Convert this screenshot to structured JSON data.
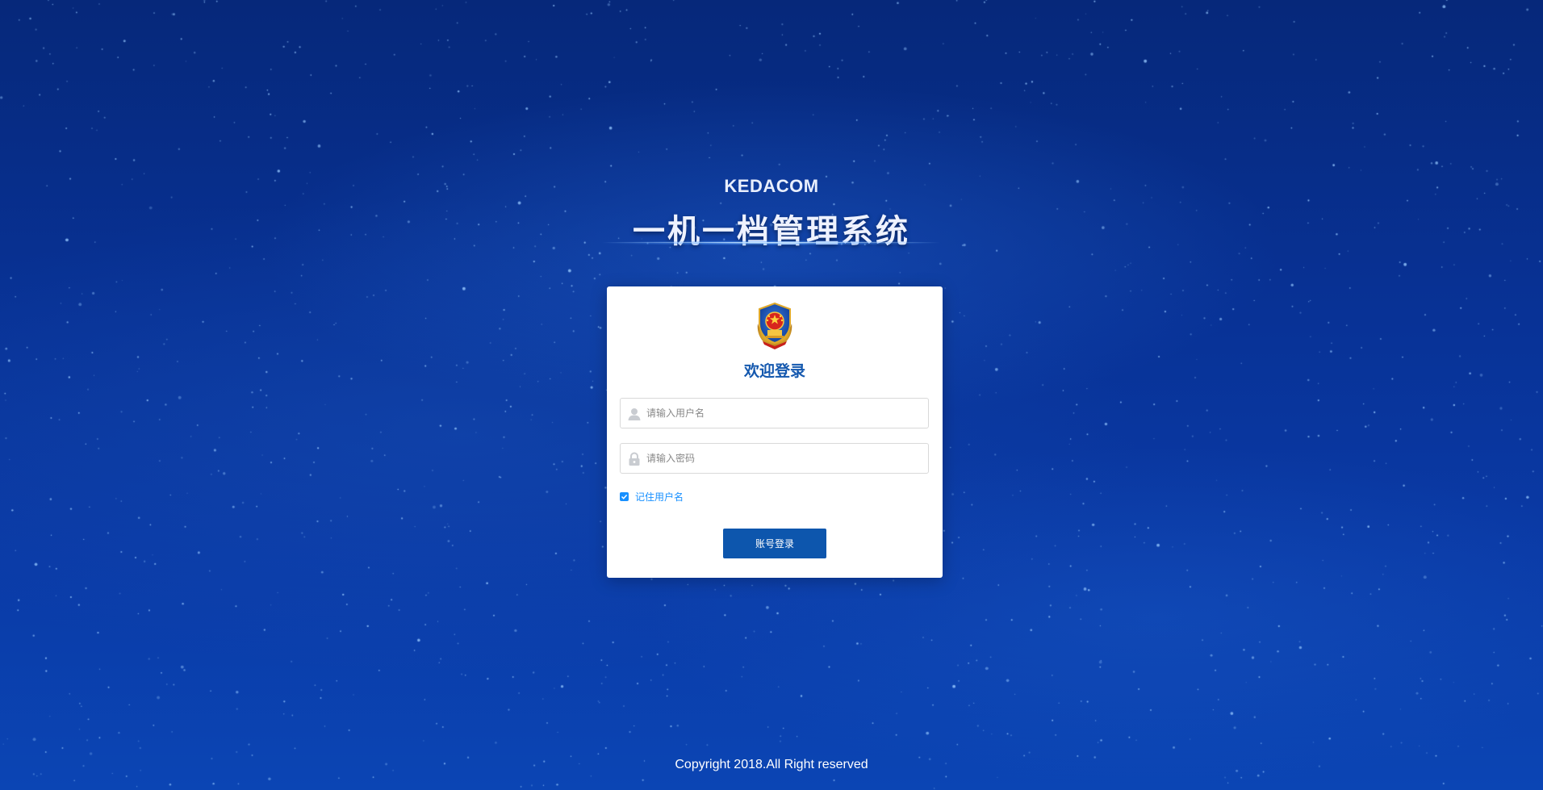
{
  "header": {
    "brand": "KEDACOM",
    "system_title": "一机一档管理系统"
  },
  "login": {
    "emblem_icon": "police-emblem-icon",
    "welcome": "欢迎登录",
    "username": {
      "placeholder": "请输入用户名",
      "value": "",
      "icon": "user-icon"
    },
    "password": {
      "placeholder": "请输入密码",
      "value": "",
      "icon": "lock-icon"
    },
    "remember": {
      "label": "记住用户名",
      "checked": true
    },
    "submit_label": "账号登录"
  },
  "footer": {
    "copyright": "Copyright 2018.All Right reserved"
  },
  "colors": {
    "accent": "#1890ff",
    "primary_button": "#0d56ad",
    "welcome_text": "#1458ae"
  }
}
